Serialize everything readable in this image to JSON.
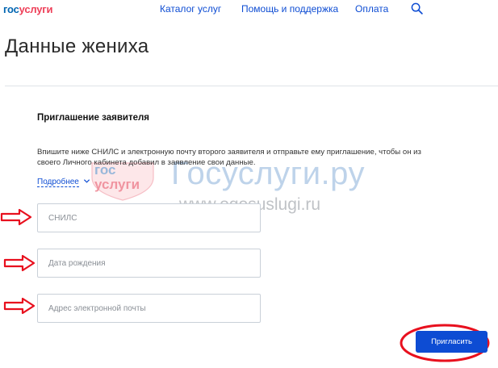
{
  "header": {
    "logo_gos": "гос",
    "logo_uslugi": "услуги",
    "nav": {
      "catalog": "Каталог услуг",
      "help": "Помощь и поддержка",
      "payment": "Оплата"
    },
    "search_icon": "search-icon"
  },
  "page": {
    "title": "Данные жениха"
  },
  "invitation": {
    "section_title": "Приглашение заявителя",
    "description": "Впишите ниже СНИЛС и электронную почту второго заявителя и отправьте ему приглашение, чтобы он из своего Личного кабинета добавил в заявление свои данные.",
    "more_link": "Подробнее",
    "fields": {
      "snils_placeholder": "СНИЛС",
      "birthdate_placeholder": "Дата рождения",
      "email_placeholder": "Адрес электронной почты"
    },
    "submit_label": "Пригласить"
  },
  "watermark": {
    "logo_gos": "гос",
    "logo_uslugi": "услуги",
    "big_text": "Госуслуги.ру",
    "url": "www.ogosuslugi.ru"
  },
  "colors": {
    "link_blue": "#0d4cd3",
    "logo_blue": "#0065b1",
    "logo_red": "#ee3f58",
    "annotation_red": "#e8101e"
  }
}
